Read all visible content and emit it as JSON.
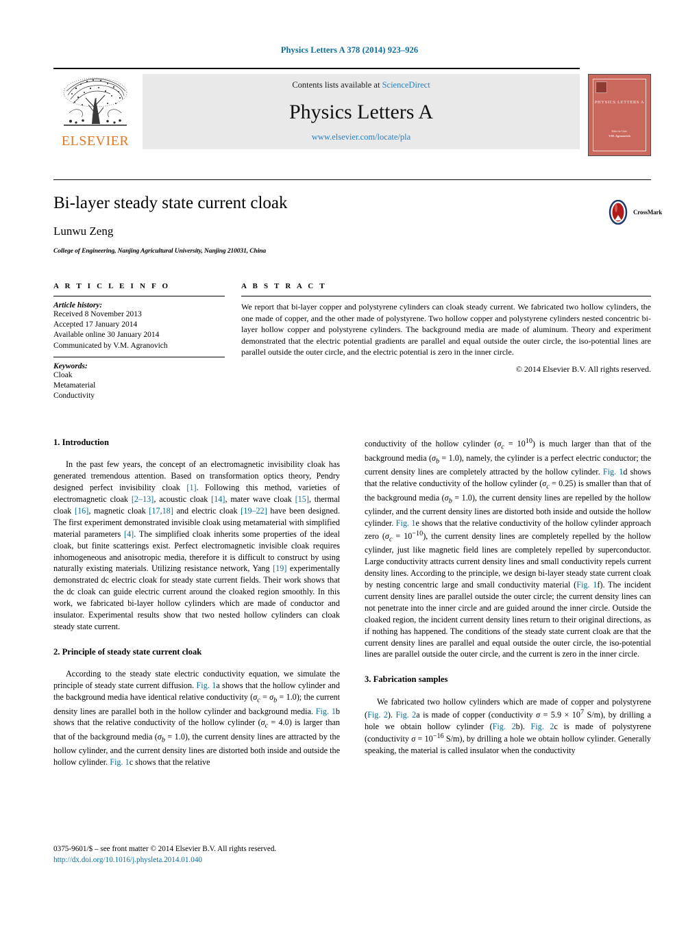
{
  "running_head": "Physics Letters A 378 (2014) 923–926",
  "masthead": {
    "publisher": "ELSEVIER",
    "contents_prefix": "Contents lists available at ",
    "sciencedirect": "ScienceDirect",
    "journal_name": "Physics Letters A",
    "journal_url": "www.elsevier.com/locate/pla"
  },
  "cover": {
    "title": "PHYSICS LETTERS A",
    "foot_line1": "Editor-in-Chief:",
    "foot_line2": "V.M. Agranovich"
  },
  "article": {
    "title": "Bi-layer steady state current cloak",
    "author": "Lunwu Zeng",
    "affiliation": "College of Engineering, Nanjing Agricultural University, Nanjing 210031, China",
    "crossmark_label": "CrossMark"
  },
  "info": {
    "heading": "A R T I C L E    I N F O",
    "history_label": "Article history:",
    "history": [
      "Received 8 November 2013",
      "Accepted 17 January 2014",
      "Available online 30 January 2014",
      "Communicated by V.M. Agranovich"
    ],
    "keywords_label": "Keywords:",
    "keywords": [
      "Cloak",
      "Metamaterial",
      "Conductivity"
    ]
  },
  "abstract": {
    "heading": "A B S T R A C T",
    "text": "We report that bi-layer copper and polystyrene cylinders can cloak steady current. We fabricated two hollow cylinders, the one made of copper, and the other made of polystyrene. Two hollow copper and polystyrene cylinders nested concentric bi-layer hollow copper and polystyrene cylinders. The background media are made of aluminum. Theory and experiment demonstrated that the electric potential gradients are parallel and equal outside the outer circle, the iso-potential lines are parallel outside the outer circle, and the electric potential is zero in the inner circle.",
    "copyright": "© 2014 Elsevier B.V. All rights reserved."
  },
  "sections": {
    "intro_heading": "1. Introduction",
    "principle_heading": "2. Principle of steady state current cloak",
    "fabrication_heading": "3. Fabrication samples"
  },
  "footer": {
    "issn_line": "0375-9601/$ – see front matter © 2014 Elsevier B.V. All rights reserved.",
    "doi": "http://dx.doi.org/10.1016/j.physleta.2014.01.040"
  },
  "colors": {
    "link_blue": "#0b6d9c",
    "sciencedirect_blue": "#2a7fc1",
    "elsevier_orange": "#e87722",
    "cover_red": "#c9695e",
    "band_gray": "#e9e9e9"
  }
}
